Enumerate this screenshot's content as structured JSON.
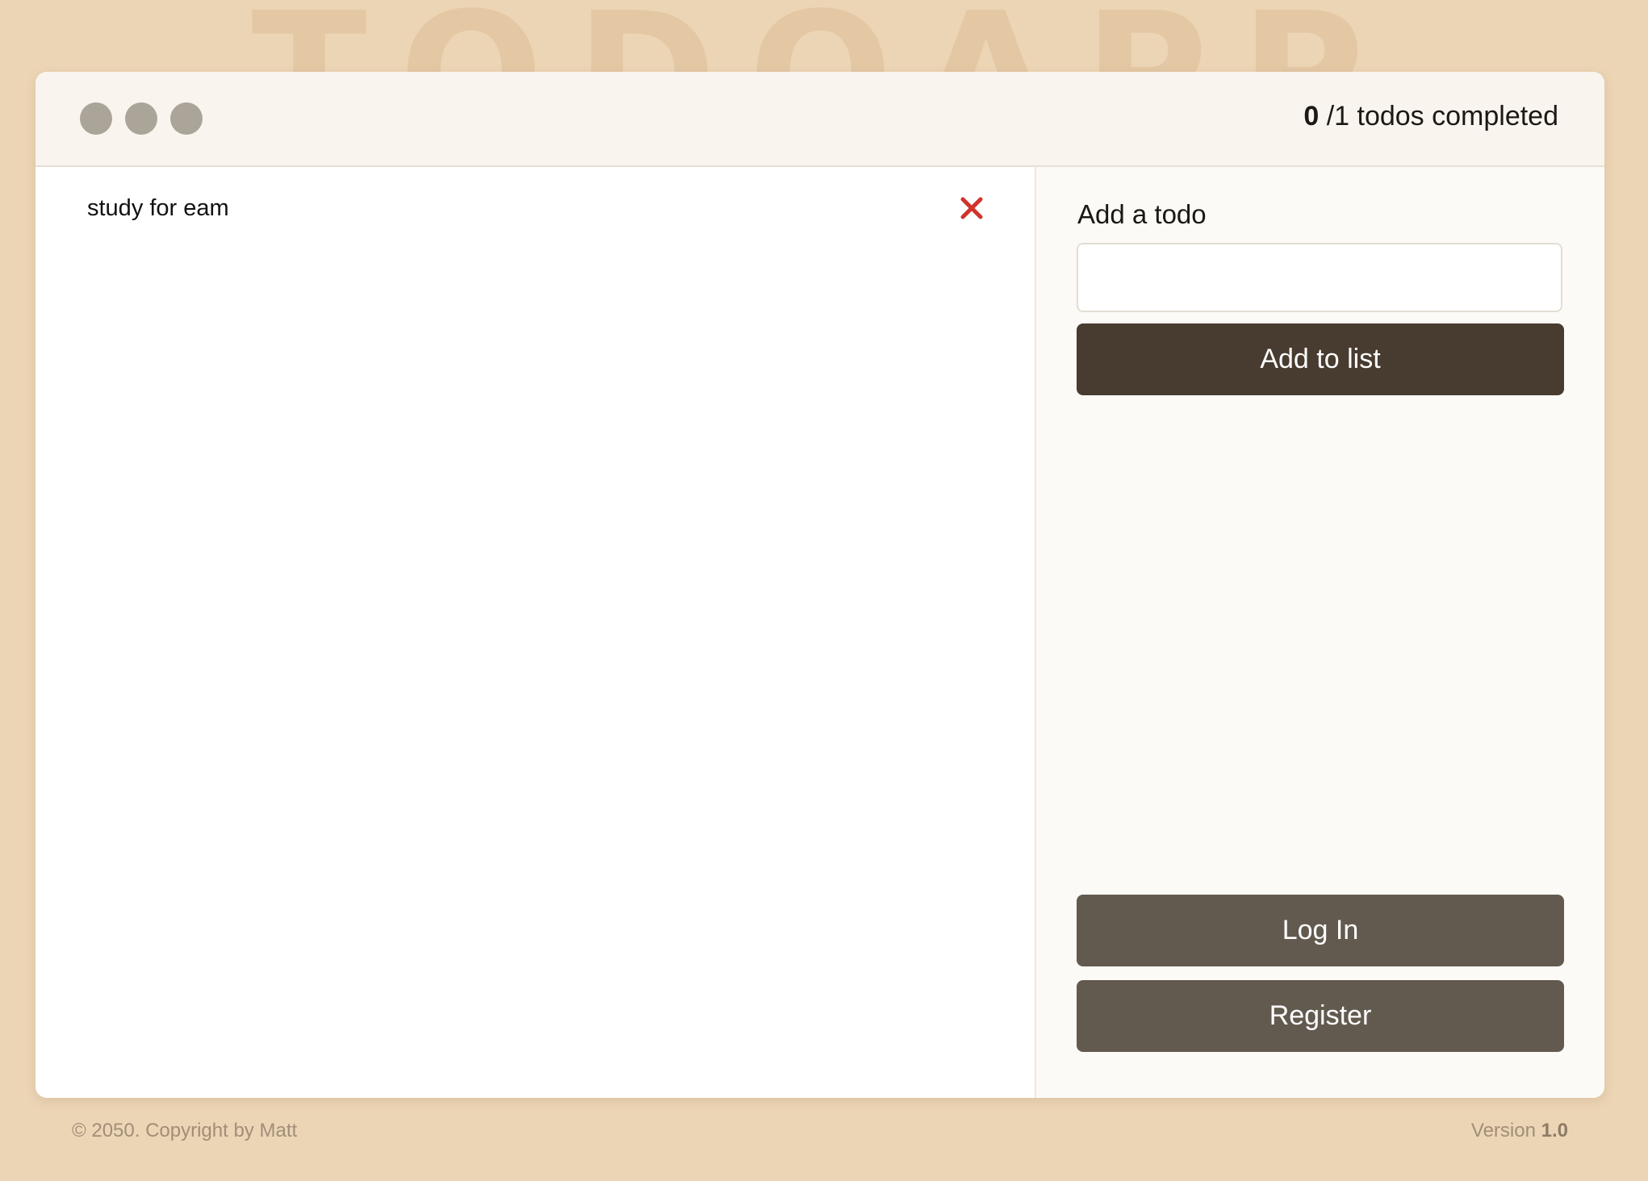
{
  "background": {
    "title": "TODOAPP"
  },
  "header": {
    "completed_count": "0",
    "completed_suffix": "/1 todos completed"
  },
  "todos": [
    {
      "text": "study for eam"
    }
  ],
  "sidebar": {
    "add_label": "Add a todo",
    "input_value": "",
    "input_placeholder": "",
    "add_button": "Add to list",
    "login_button": "Log In",
    "register_button": "Register"
  },
  "footer": {
    "copyright": "© 2050. Copyright by Matt",
    "version_label": "Version",
    "version_number": "1.0"
  },
  "colors": {
    "page_bg": "#ecd5b5",
    "primary_button": "#483b2f",
    "secondary_button": "#635a4f",
    "delete_icon": "#d0342c"
  },
  "icons": {
    "window_controls": "traffic-light-dots",
    "delete": "close-icon"
  }
}
